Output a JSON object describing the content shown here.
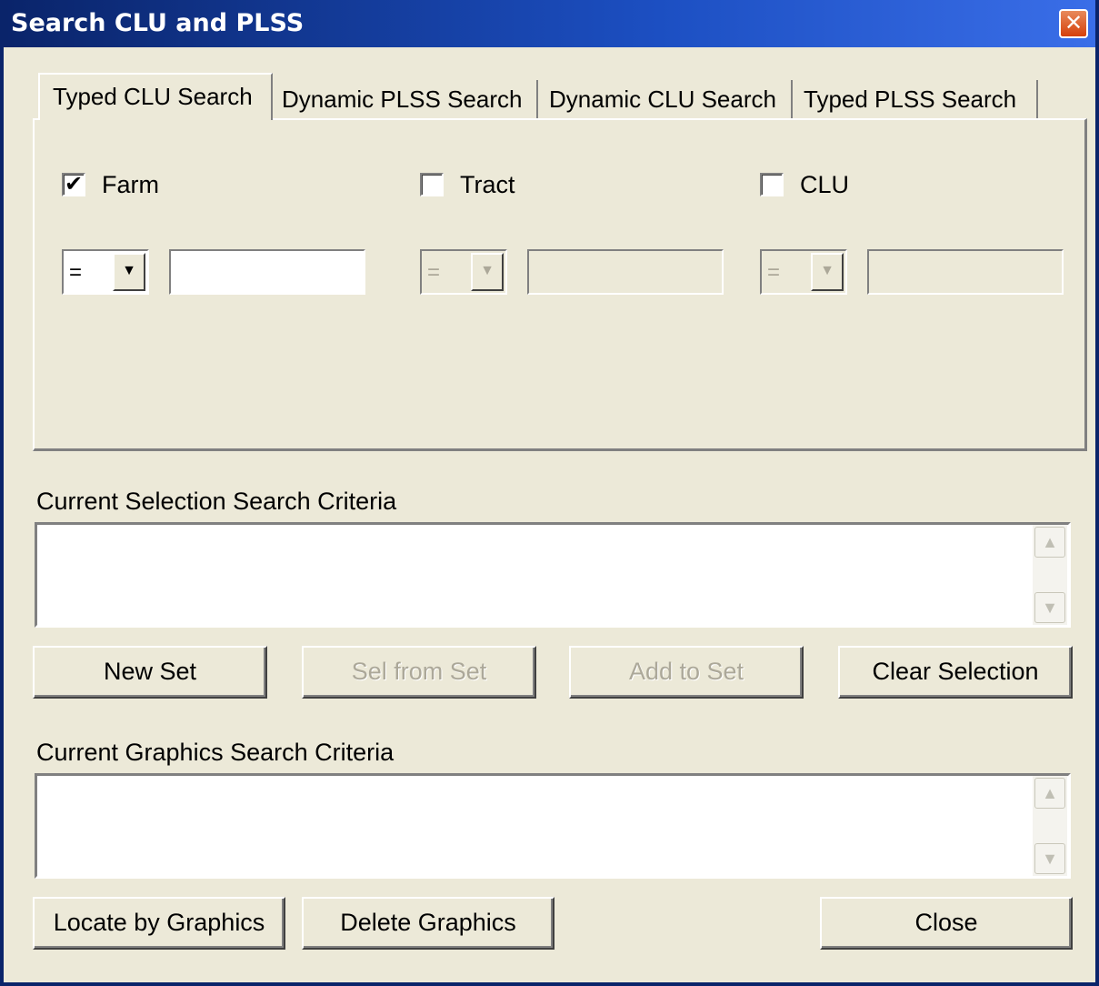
{
  "window": {
    "title": "Search CLU and PLSS",
    "close_glyph": "✕"
  },
  "tabs": [
    {
      "label": "Typed CLU Search",
      "active": true
    },
    {
      "label": "Dynamic PLSS Search",
      "active": false
    },
    {
      "label": "Dynamic CLU Search",
      "active": false
    },
    {
      "label": "Typed PLSS Search",
      "active": false
    }
  ],
  "criteria": [
    {
      "label": "Farm",
      "checked": true,
      "operator": "=",
      "value": "",
      "enabled": true
    },
    {
      "label": "Tract",
      "checked": false,
      "operator": "=",
      "value": "",
      "enabled": false
    },
    {
      "label": "CLU",
      "checked": false,
      "operator": "=",
      "value": "",
      "enabled": false
    }
  ],
  "selection": {
    "label": "Current Selection Search Criteria",
    "text": "",
    "buttons": {
      "new_set": "New Set",
      "sel_from_set": "Sel from Set",
      "add_to_set": "Add to Set",
      "clear_selection": "Clear Selection"
    }
  },
  "graphics": {
    "label": "Current Graphics Search Criteria",
    "text": "",
    "buttons": {
      "locate": "Locate by Graphics",
      "delete": "Delete Graphics",
      "close": "Close"
    }
  },
  "icons": {
    "check": "✔",
    "dropdown": "▼",
    "scroll_up": "▲",
    "scroll_down": "▼"
  }
}
